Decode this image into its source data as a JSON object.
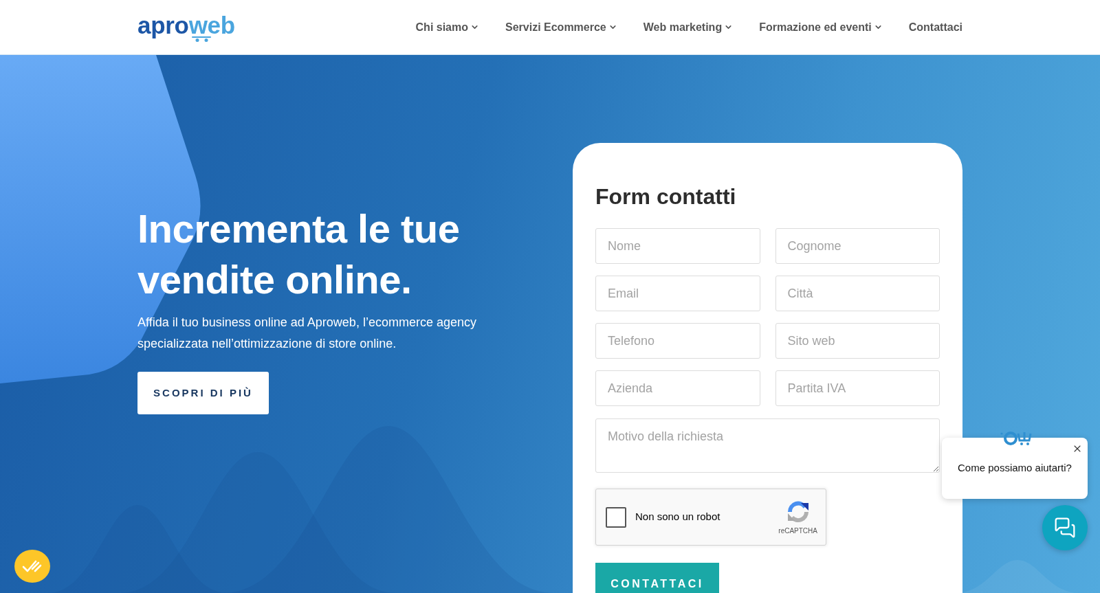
{
  "header": {
    "logo": {
      "parts": [
        "apro",
        "web"
      ]
    },
    "nav": [
      {
        "label": "Chi siamo",
        "dropdown": true
      },
      {
        "label": "Servizi Ecommerce",
        "dropdown": true
      },
      {
        "label": "Web marketing",
        "dropdown": true
      },
      {
        "label": "Formazione ed eventi",
        "dropdown": true
      },
      {
        "label": "Contattaci",
        "dropdown": false
      }
    ]
  },
  "hero": {
    "title": "Incrementa le tue vendite online.",
    "subtitle": "Affida il tuo business online ad Aproweb, l’ecommerce agency specializzata nell’ottimizzazione di store online.",
    "button": "SCOPRI DI PIÙ"
  },
  "contact_form": {
    "title": "Form contatti",
    "fields": [
      {
        "placeholder": "Nome"
      },
      {
        "placeholder": "Cognome"
      },
      {
        "placeholder": "Email"
      },
      {
        "placeholder": "Città"
      },
      {
        "placeholder": "Telefono"
      },
      {
        "placeholder": "Sito web"
      },
      {
        "placeholder": "Azienda"
      },
      {
        "placeholder": "Partita IVA"
      }
    ],
    "message": {
      "placeholder": "Motivo della richiesta"
    },
    "recaptcha": {
      "label": "Non sono un robot",
      "checked": false,
      "brand": "reCAPTCHA"
    },
    "submit": "CONTATTACI"
  },
  "chat": {
    "message": "Come possiamo aiutarti?"
  }
}
